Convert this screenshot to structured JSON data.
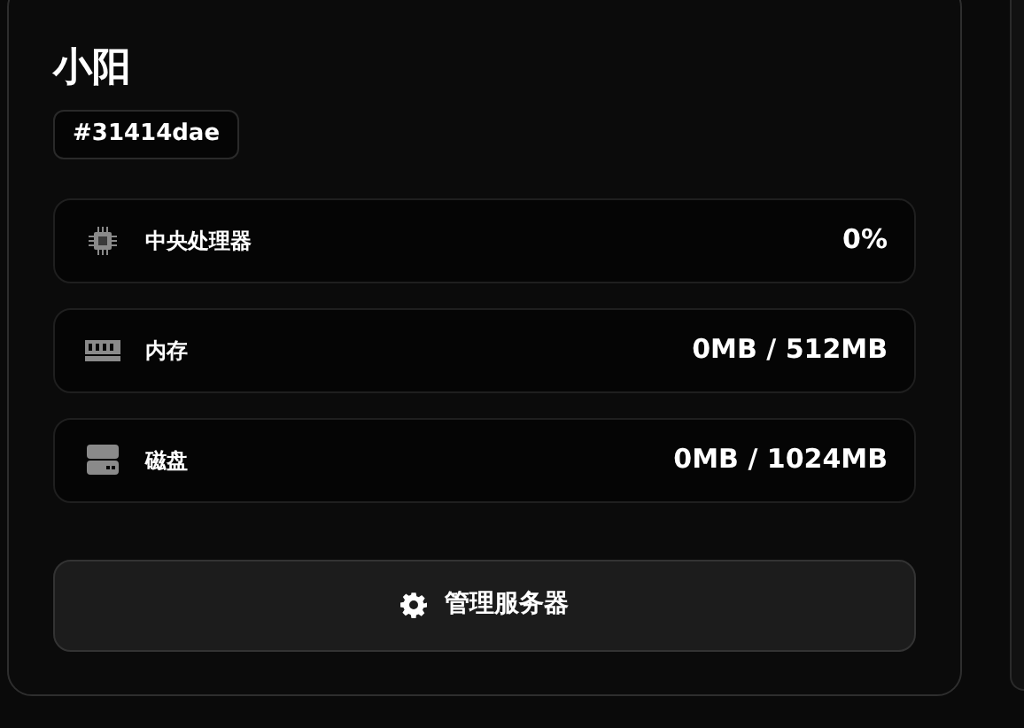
{
  "server": {
    "name": "小阳",
    "id": "#31414dae"
  },
  "stats": [
    {
      "kind": "cpu",
      "label": "中央处理器",
      "value": "0%"
    },
    {
      "kind": "memory",
      "label": "内存",
      "value": "0MB / 512MB"
    },
    {
      "kind": "disk",
      "label": "磁盘",
      "value": "0MB / 1024MB"
    }
  ],
  "manage_button": {
    "label": "管理服务器"
  }
}
